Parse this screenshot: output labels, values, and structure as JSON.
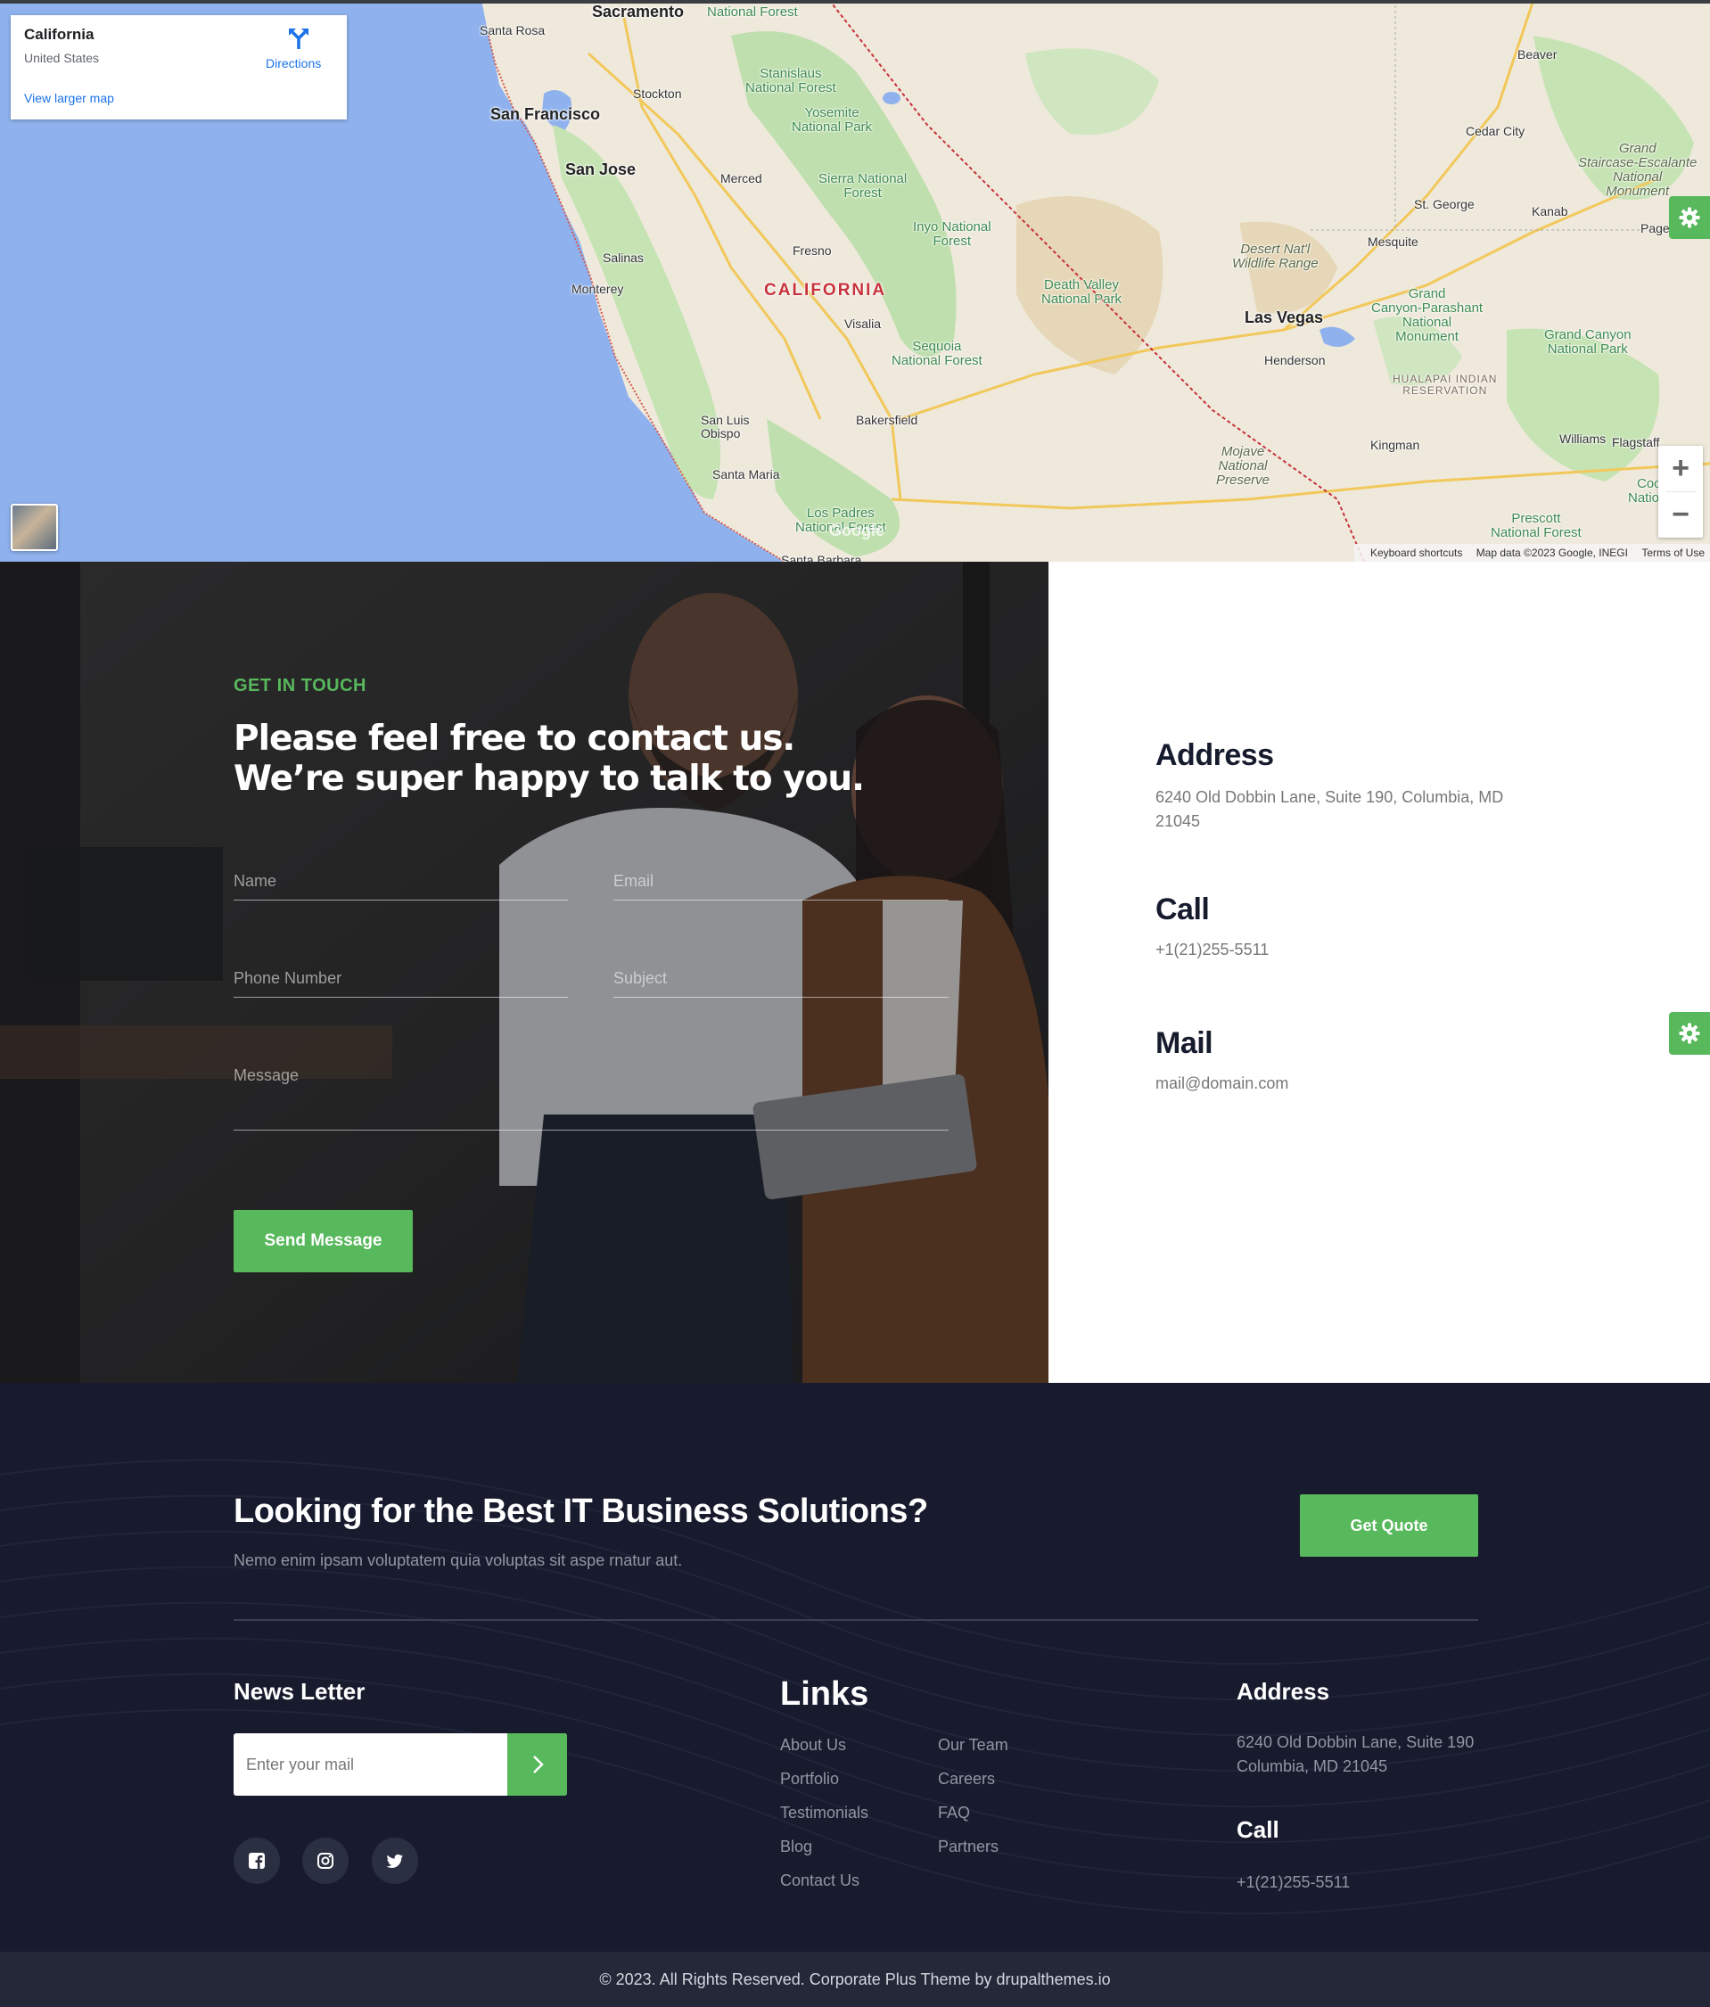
{
  "map": {
    "card": {
      "place": "California",
      "country": "United States",
      "directions_label": "Directions",
      "larger_map_label": "View larger map"
    },
    "labels": {
      "sacramento": "Sacramento",
      "santa_rosa": "Santa Rosa",
      "stockton": "Stockton",
      "san_francisco": "San Francisco",
      "san_jose": "San Jose",
      "merced": "Merced",
      "salinas": "Salinas",
      "monterey": "Monterey",
      "fresno": "Fresno",
      "visalia": "Visalia",
      "california": "CALIFORNIA",
      "bakersfield": "Bakersfield",
      "san_luis_obispo": "San Luis\nObispo",
      "santa_maria": "Santa Maria",
      "santa_barbara": "Santa Barbara",
      "los_padres": "Los Padres\nNational Forest",
      "stanislaus": "Stanislaus\nNational Forest",
      "yosemite": "Yosemite\nNational Park",
      "sierra": "Sierra National\nForest",
      "inyo": "Inyo National\nForest",
      "sequoia": "Sequoia\nNational Forest",
      "death_valley": "Death Valley\nNational Park",
      "desert_nwr": "Desert Nat'l\nWildlife Range",
      "las_vegas": "Las Vegas",
      "henderson": "Henderson",
      "mesquite": "Mesquite",
      "st_george": "St. George",
      "kanab": "Kanab",
      "cedar_city": "Cedar City",
      "beaver": "Beaver",
      "grand_staircase": "Grand\nStaircase-Escalante\nNational\nMonument",
      "page": "Page",
      "parashant": "Grand\nCanyon-Parashant\nNational\nMonument",
      "grand_canyon": "Grand Canyon\nNational Park",
      "hualapai": "HUALAPAI INDIAN\nRESERVATION",
      "kingman": "Kingman",
      "williams": "Williams",
      "flagstaff": "Flagstaff",
      "mojave": "Mojave\nNational\nPreserve",
      "prescott": "Prescott\nNational Forest",
      "coconino": "Coco\nNational",
      "national_forest_top": "National Forest"
    },
    "footer": {
      "shortcuts": "Keyboard shortcuts",
      "data": "Map data ©2023 Google, INEGI",
      "terms": "Terms of Use"
    },
    "google_logo": "Google",
    "zoom_in": "+",
    "zoom_out": "−"
  },
  "contact": {
    "eyebrow": "GET IN TOUCH",
    "heading": "Please feel free to contact us. We’re super happy to talk to you.",
    "fields": {
      "name": "Name",
      "email": "Email",
      "phone": "Phone Number",
      "subject": "Subject",
      "message": "Message"
    },
    "send_label": "Send Message",
    "address_title": "Address",
    "address_text": "6240 Old Dobbin Lane, Suite 190, Columbia, MD 21045",
    "call_title": "Call",
    "call_text": "+1(21)255-5511",
    "mail_title": "Mail",
    "mail_text": "mail@domain.com"
  },
  "footer": {
    "cta_title": "Looking for the Best IT Business Solutions?",
    "cta_sub": "Nemo enim ipsam voluptatem quia voluptas sit aspe rnatur aut.",
    "quote_label": "Get Quote",
    "newsletter_title": "News Letter",
    "newsletter_placeholder": "Enter your mail",
    "links_title": "Links",
    "links_col1": [
      "About Us",
      "Portfolio",
      "Testimonials",
      "Blog",
      "Contact Us"
    ],
    "links_col2": [
      "Our Team",
      "Careers",
      "FAQ",
      "Partners"
    ],
    "address_title": "Address",
    "address_text": "6240 Old Dobbin Lane, Suite 190 Columbia, MD 21045",
    "call_title": "Call",
    "call_text": "+1(21)255-5511",
    "social_icons": [
      "facebook-icon",
      "instagram-icon",
      "twitter-icon"
    ],
    "copyright": "© 2023. All Rights Reserved. Corporate Plus Theme by drupalthemes.io"
  },
  "colors": {
    "accent": "#58b85c",
    "footer_bg": "#171b2d",
    "copyright_bg": "#242839",
    "heading_dark": "#161b2d",
    "map_water": "#8fb2ee"
  }
}
